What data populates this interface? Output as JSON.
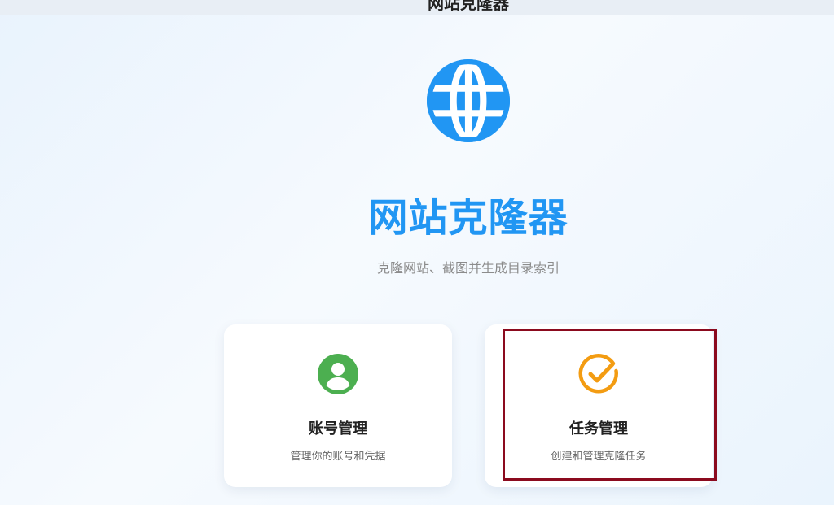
{
  "header": {
    "title": "网站克隆器"
  },
  "hero": {
    "icon": "globe-icon",
    "title": "网站克隆器",
    "subtitle": "克隆网站、截图并生成目录索引"
  },
  "cards": [
    {
      "icon": "user-circle-icon",
      "title": "账号管理",
      "description": "管理你的账号和凭据",
      "accent": "#4caf50"
    },
    {
      "icon": "check-circle-icon",
      "title": "任务管理",
      "description": "创建和管理克隆任务",
      "accent": "#f39c12"
    }
  ],
  "colors": {
    "primary": "#2196f3",
    "highlight": "#8b0a1e"
  }
}
